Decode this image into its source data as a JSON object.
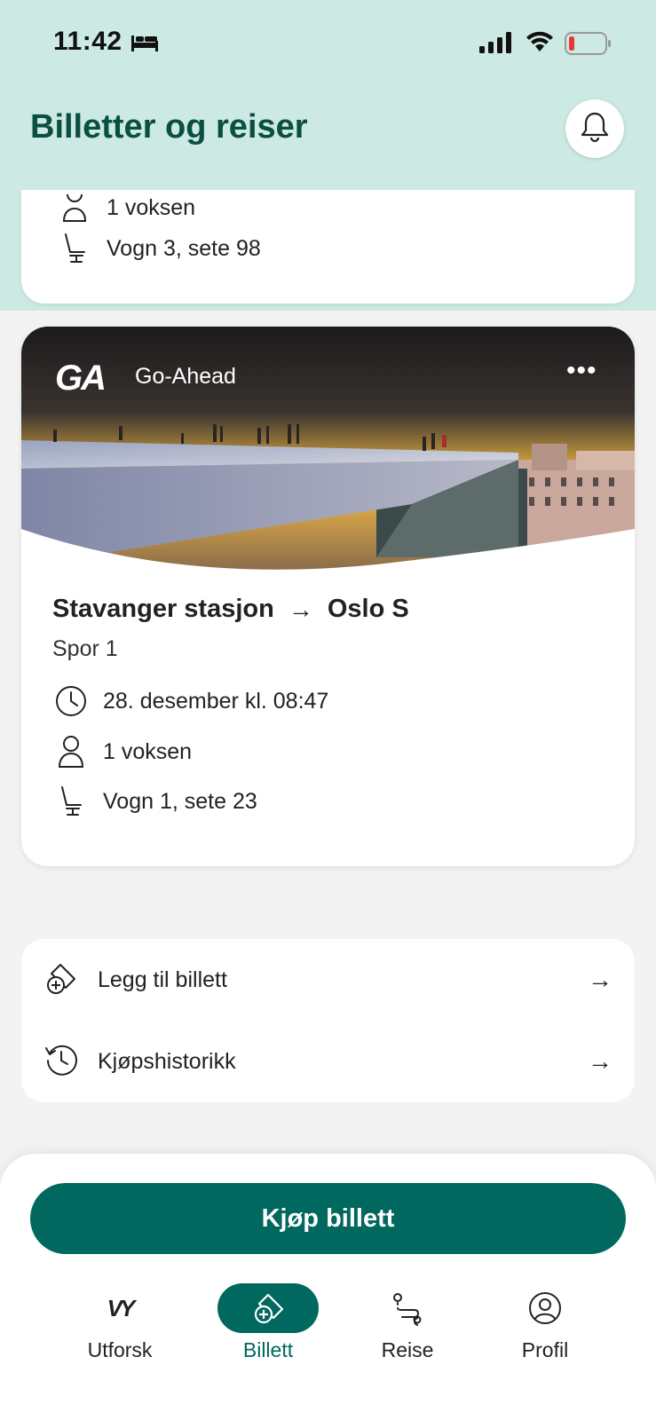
{
  "status_bar": {
    "time": "11:42"
  },
  "header": {
    "title": "Billetter og reiser"
  },
  "partial_ticket": {
    "passengers": "1 voksen",
    "seat": "Vogn 3, sete 98"
  },
  "ticket": {
    "operator_logo": "GA",
    "operator_name": "Go-Ahead",
    "more": "•••",
    "from": "Stavanger stasjon",
    "arrow": "→",
    "to": "Oslo S",
    "platform": "Spor 1",
    "departure": "28. desember kl. 08:47",
    "passengers": "1 voksen",
    "seat": "Vogn 1, sete 23"
  },
  "actions": [
    {
      "label": "Legg til billett",
      "icon": "add-ticket-icon"
    },
    {
      "label": "Kjøpshistorikk",
      "icon": "history-icon"
    }
  ],
  "action_arrow": "→",
  "buy_button": "Kjøp billett",
  "nav": {
    "logo": "VY",
    "items": [
      {
        "label": "Utforsk",
        "icon": "vy-logo-icon"
      },
      {
        "label": "Billett",
        "icon": "ticket-icon",
        "active": true
      },
      {
        "label": "Reise",
        "icon": "route-icon"
      },
      {
        "label": "Profil",
        "icon": "profile-icon"
      }
    ]
  },
  "colors": {
    "header_bg": "#cce9e3",
    "title": "#0a4f42",
    "primary": "#00685e",
    "battery_low": "#e53935"
  }
}
